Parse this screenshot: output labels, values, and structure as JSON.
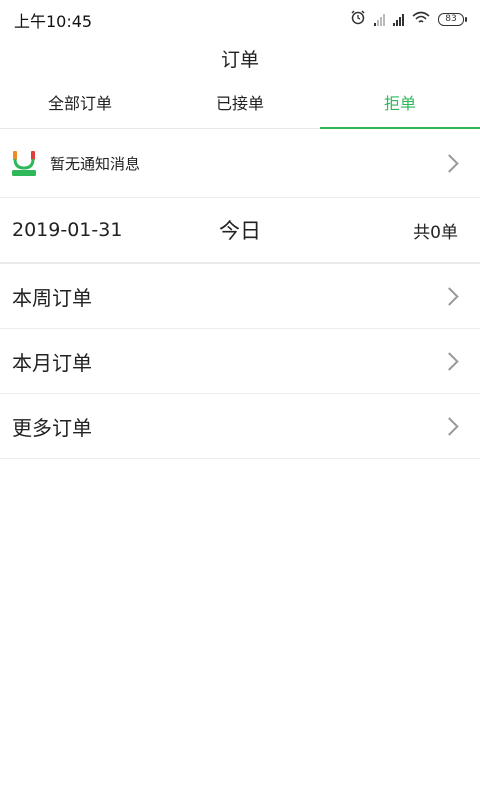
{
  "status": {
    "time": "上午10:45",
    "battery": "83"
  },
  "header": {
    "title": "订单"
  },
  "tabs": [
    {
      "label": "全部订单",
      "active": false
    },
    {
      "label": "已接单",
      "active": false
    },
    {
      "label": "拒单",
      "active": true
    }
  ],
  "notice": {
    "text": "暂无通知消息"
  },
  "summary": {
    "date": "2019-01-31",
    "today": "今日",
    "count": "共0单"
  },
  "rows": [
    {
      "label": "本周订单"
    },
    {
      "label": "本月订单"
    },
    {
      "label": "更多订单"
    }
  ],
  "colors": {
    "accent": "#2fb859",
    "text": "#222222",
    "chevron": "#9a9a9a",
    "divider": "#ececec"
  }
}
